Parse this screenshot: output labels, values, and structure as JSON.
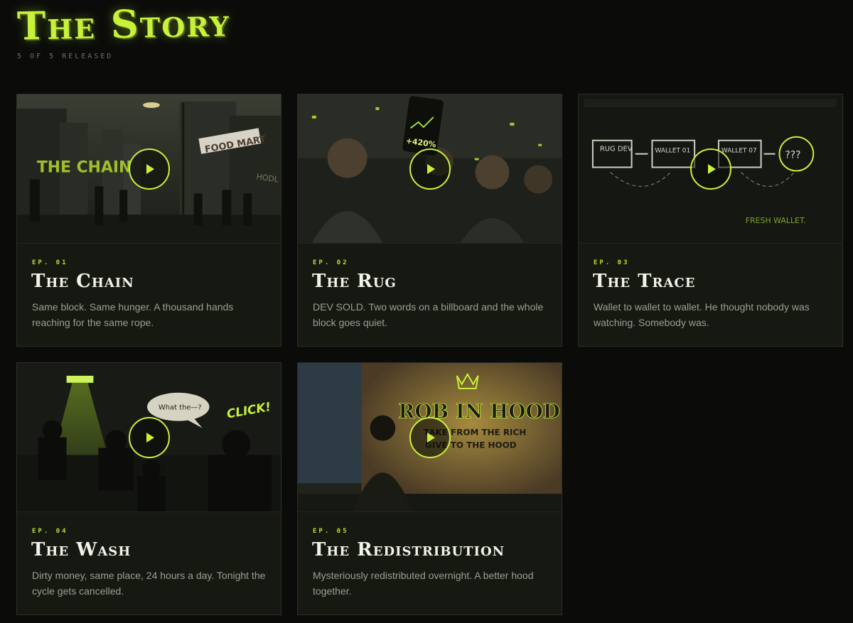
{
  "header": {
    "title": "The Story",
    "release_status": "5 OF 5 RELEASED"
  },
  "colors": {
    "accent": "#c8f23a",
    "background": "#0b0c0a",
    "card": "#161812"
  },
  "episodes": [
    {
      "label": "EP. 01",
      "title": "The Chain",
      "description": "Same block. Same hunger. A thousand hands reaching for the same rope.",
      "thumbnail_text": [
        "THE CHAIN",
        "FOOD MART",
        "HODL OR DIE"
      ]
    },
    {
      "label": "EP. 02",
      "title": "The Rug",
      "description": "DEV SOLD. Two words on a billboard and the whole block goes quiet.",
      "thumbnail_text": [
        "+420%"
      ]
    },
    {
      "label": "EP. 03",
      "title": "The Trace",
      "description": "Wallet to wallet to wallet. He thought nobody was watching. Somebody was.",
      "thumbnail_text": [
        "RUG DEV",
        "WALLET 01",
        "WALLET 07",
        "???",
        "FRESH WALLET."
      ]
    },
    {
      "label": "EP. 04",
      "title": "The Wash",
      "description": "Dirty money, same place, 24 hours a day. Tonight the cycle gets cancelled.",
      "thumbnail_text": [
        "What the—?",
        "CLICK!"
      ]
    },
    {
      "label": "EP. 05",
      "title": "The Redistribution",
      "description": "Mysteriously redistributed overnight. A better hood together.",
      "thumbnail_text": [
        "ROB IN HOOD",
        "TAKE FROM THE RICH",
        "GIVE TO THE HOOD"
      ]
    }
  ]
}
